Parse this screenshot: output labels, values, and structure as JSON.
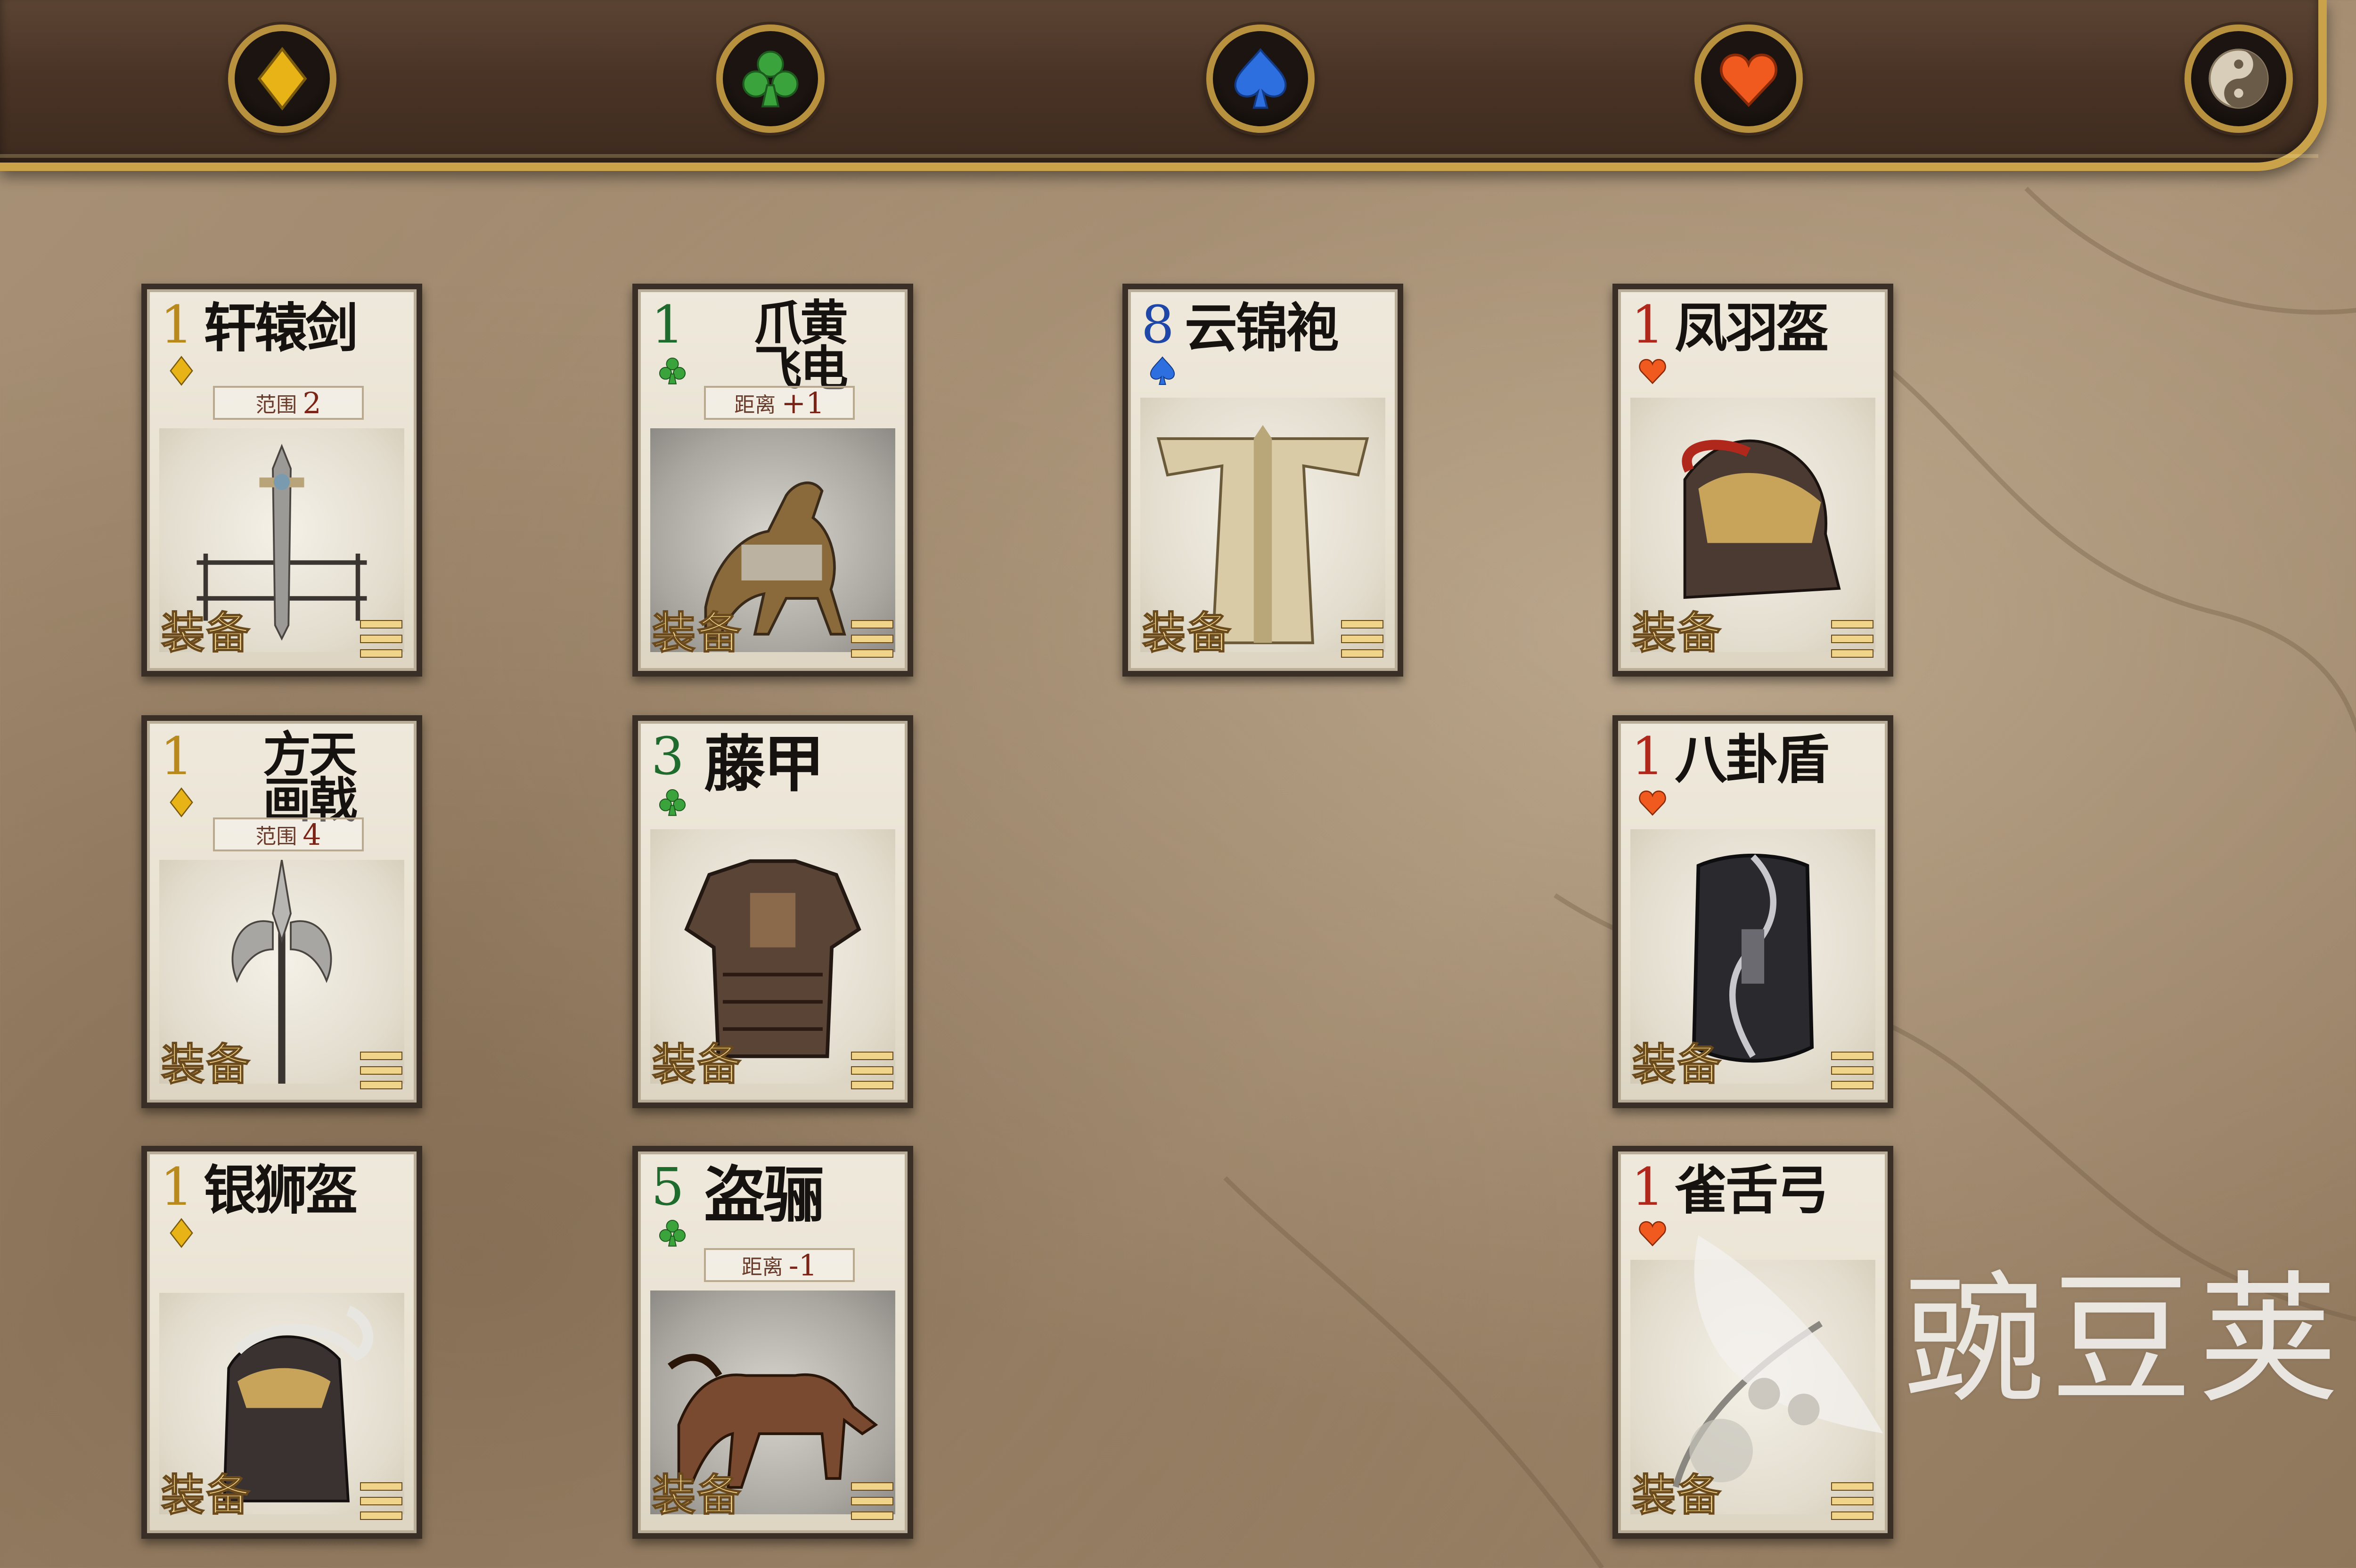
{
  "topbar": {
    "filters": [
      {
        "name": "diamond-icon",
        "color": "#e8b317"
      },
      {
        "name": "club-icon",
        "color": "#3aa33c"
      },
      {
        "name": "spade-icon",
        "color": "#2e6fe0"
      },
      {
        "name": "heart-icon",
        "color": "#f05a1e"
      },
      {
        "name": "yin-yang-icon",
        "color": "#d8cdb8"
      }
    ]
  },
  "cards": [
    {
      "id": "xuanyuan",
      "number": "1",
      "suit": "diamond",
      "title": "轩辕剑",
      "stat_label": "范围",
      "stat_value": "2",
      "tag": "装备"
    },
    {
      "id": "zhuahuang",
      "number": "1",
      "suit": "club",
      "title": "爪黄飞电",
      "title_line1": "爪黄",
      "title_line2": "飞电",
      "stat_label": "距离",
      "stat_value": "+1",
      "tag": "装备"
    },
    {
      "id": "yunjin",
      "number": "8",
      "suit": "spade",
      "title": "云锦袍",
      "tag": "装备"
    },
    {
      "id": "fengyu",
      "number": "1",
      "suit": "heart",
      "title": "凤羽盔",
      "tag": "装备"
    },
    {
      "id": "fangtian",
      "number": "1",
      "suit": "diamond",
      "title": "方天画戟",
      "title_line1": "方天",
      "title_line2": "画戟",
      "stat_label": "范围",
      "stat_value": "4",
      "tag": "装备"
    },
    {
      "id": "tengjia",
      "number": "3",
      "suit": "club",
      "title": "藤甲",
      "tag": "装备"
    },
    {
      "id": "bagua",
      "number": "1",
      "suit": "heart",
      "title": "八卦盾",
      "tag": "装备"
    },
    {
      "id": "yinshi",
      "number": "1",
      "suit": "diamond",
      "title": "银狮盔",
      "tag": "装备"
    },
    {
      "id": "daoli",
      "number": "5",
      "suit": "club",
      "title": "盗骊",
      "stat_label": "距离",
      "stat_value": "-1",
      "tag": "装备"
    },
    {
      "id": "queshe",
      "number": "1",
      "suit": "heart",
      "title": "雀舌弓",
      "tag": "装备"
    }
  ],
  "watermark": {
    "text": "豌豆荚"
  }
}
